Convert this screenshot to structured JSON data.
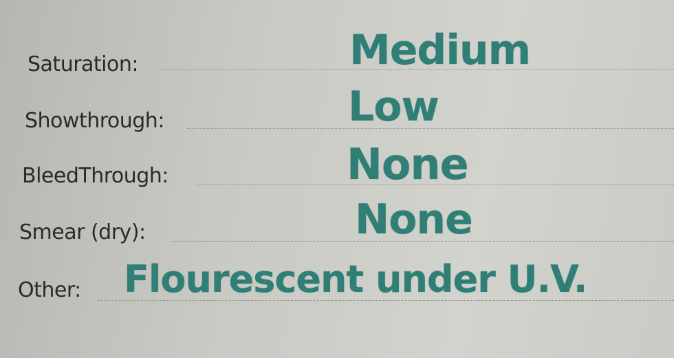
{
  "form": {
    "rows": [
      {
        "label": "Saturation:",
        "value": "Medium"
      },
      {
        "label": "Showthrough:",
        "value": "Low"
      },
      {
        "label": "BleedThrough:",
        "value": "None"
      },
      {
        "label": "Smear (dry):",
        "value": "None"
      },
      {
        "label": "Other:",
        "value": "Flourescent under U.V."
      }
    ]
  },
  "colors": {
    "ink": "#2f7f76",
    "paper": "#d0d0cb",
    "label_text": "#2a2a2a"
  }
}
